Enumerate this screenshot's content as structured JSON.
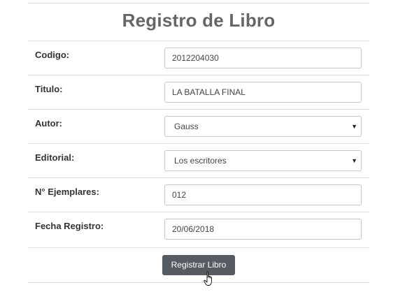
{
  "form": {
    "title": "Registro de Libro",
    "fields": [
      {
        "label": "Codigo:",
        "value": "2012204030",
        "type": "text"
      },
      {
        "label": "Titulo:",
        "value": "LA BATALLA FINAL",
        "type": "text"
      },
      {
        "label": "Autor:",
        "value": "Gauss",
        "type": "select"
      },
      {
        "label": "Editorial:",
        "value": "Los escritores",
        "type": "select"
      },
      {
        "label": "N° Ejemplares:",
        "value": "012",
        "type": "text"
      },
      {
        "label": "Fecha Registro:",
        "value": "20/06/2018",
        "type": "text"
      }
    ],
    "submit_label": "Registrar Libro"
  },
  "icons": {
    "select_caret": "chevron-down-icon",
    "cursor": "hand-pointer-icon"
  }
}
